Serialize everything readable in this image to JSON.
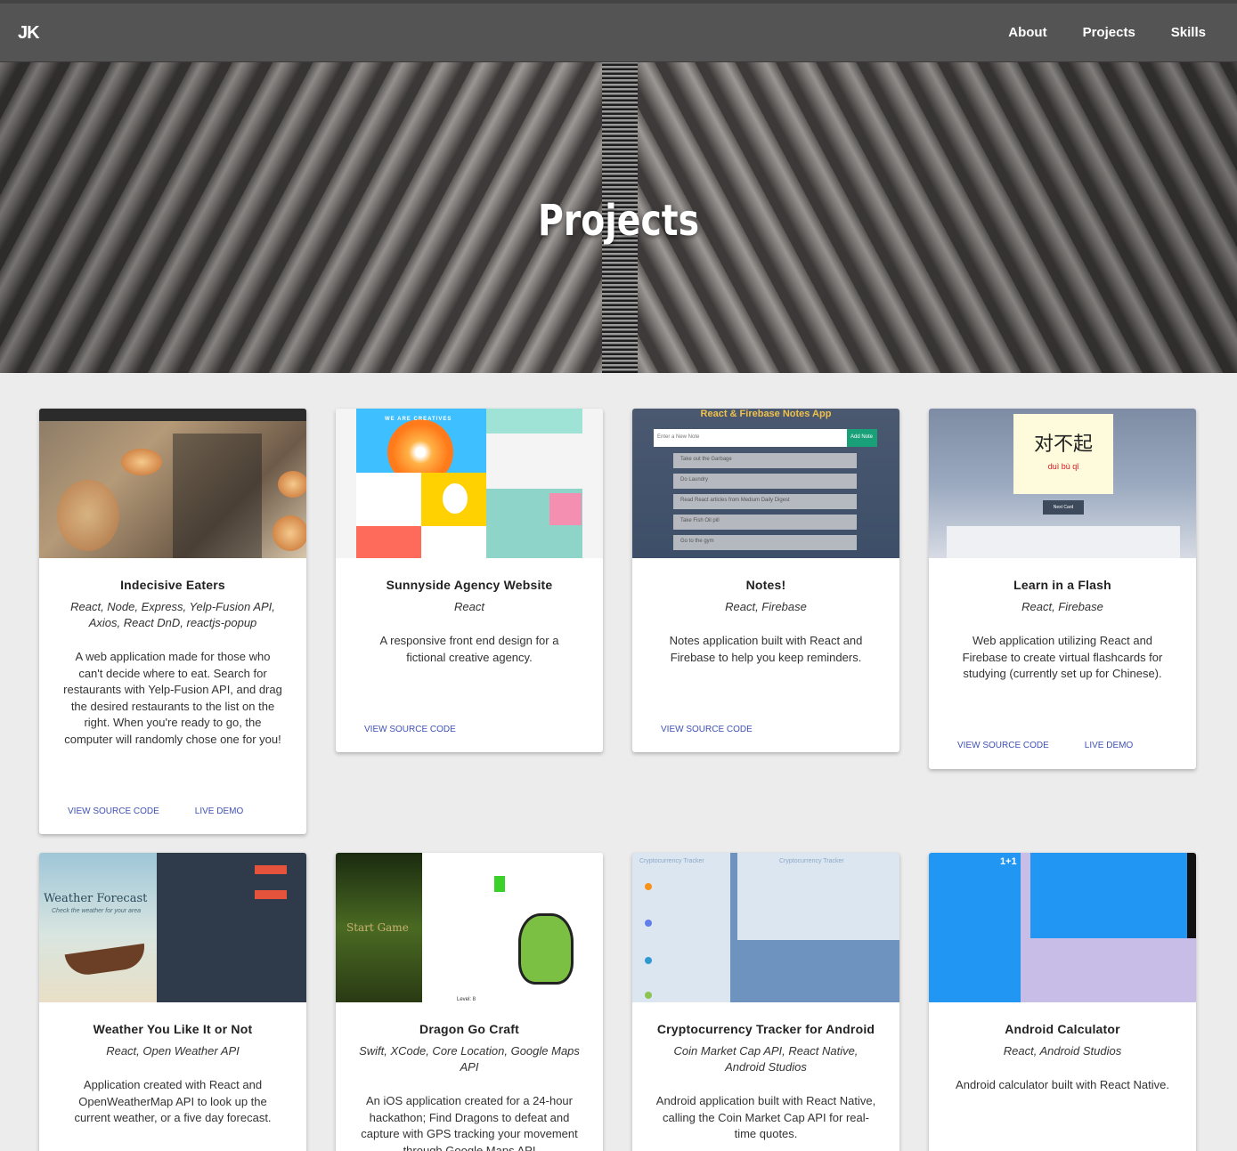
{
  "nav": {
    "logo": "JK",
    "links": [
      "About",
      "Projects",
      "Skills"
    ]
  },
  "hero": {
    "title": "Projects"
  },
  "thumbnails": {
    "notes_header": "React & Firebase Notes App",
    "notes_input": "Enter a New Note",
    "notes_add": "Add Note",
    "notes_items": [
      "Take out the Garbage",
      "Do Laundry",
      "Read React articles from Medium Daily Digest",
      "Take Fish Oil pill",
      "Go to the gym"
    ],
    "flash_hanzi": "对不起",
    "flash_pinyin": "duì bù qǐ",
    "flash_next": "Next Card",
    "weather_title": "Weather Forecast",
    "weather_sub": "Check the weather for your area",
    "dragon_start": "Start Game",
    "dragon_level": "Level: 8",
    "crypto_title": "Cryptocurrency Tracker",
    "calc_display": "1+1",
    "sunny_label": "WE ARE CREATIVES"
  },
  "projects": [
    {
      "title": "Indecisive Eaters",
      "tech": "React, Node, Express, Yelp-Fusion API, Axios, React DnD, reactjs-popup",
      "desc": "A web application made for those who can't decide where to eat. Search for restaurants with Yelp-Fusion API, and drag the desired restaurants to the list on the right. When you're ready to go, the computer will randomly chose one for you!",
      "source": "View Source Code",
      "demo": "Live Demo"
    },
    {
      "title": "Sunnyside Agency Website",
      "tech": "React",
      "desc": "A responsive front end design for a fictional creative agency.",
      "source": "View Source Code"
    },
    {
      "title": "Notes!",
      "tech": "React, Firebase",
      "desc": "Notes application built with React and Firebase to help you keep reminders.",
      "source": "View Source Code"
    },
    {
      "title": "Learn in a Flash",
      "tech": "React, Firebase",
      "desc": "Web application utilizing React and Firebase to create virtual flashcards for studying (currently set up for Chinese).",
      "source": "View Source Code",
      "demo": "Live Demo"
    },
    {
      "title": "Weather You Like It or Not",
      "tech": "React, Open Weather API",
      "desc": "Application created with React and OpenWeatherMap API to look up the current weather, or a five day forecast."
    },
    {
      "title": "Dragon Go Craft",
      "tech": "Swift, XCode, Core Location, Google Maps API",
      "desc": "An iOS application created for a 24-hour hackathon; Find Dragons to defeat and capture with GPS tracking your movement through Google Maps API"
    },
    {
      "title": "Cryptocurrency Tracker for Android",
      "tech": "Coin Market Cap API, React Native, Android Studios",
      "desc": "Android application built with React Native, calling the Coin Market Cap API for real-time quotes."
    },
    {
      "title": "Android Calculator",
      "tech": "React, Android Studios",
      "desc": "Android calculator built with React Native."
    }
  ]
}
